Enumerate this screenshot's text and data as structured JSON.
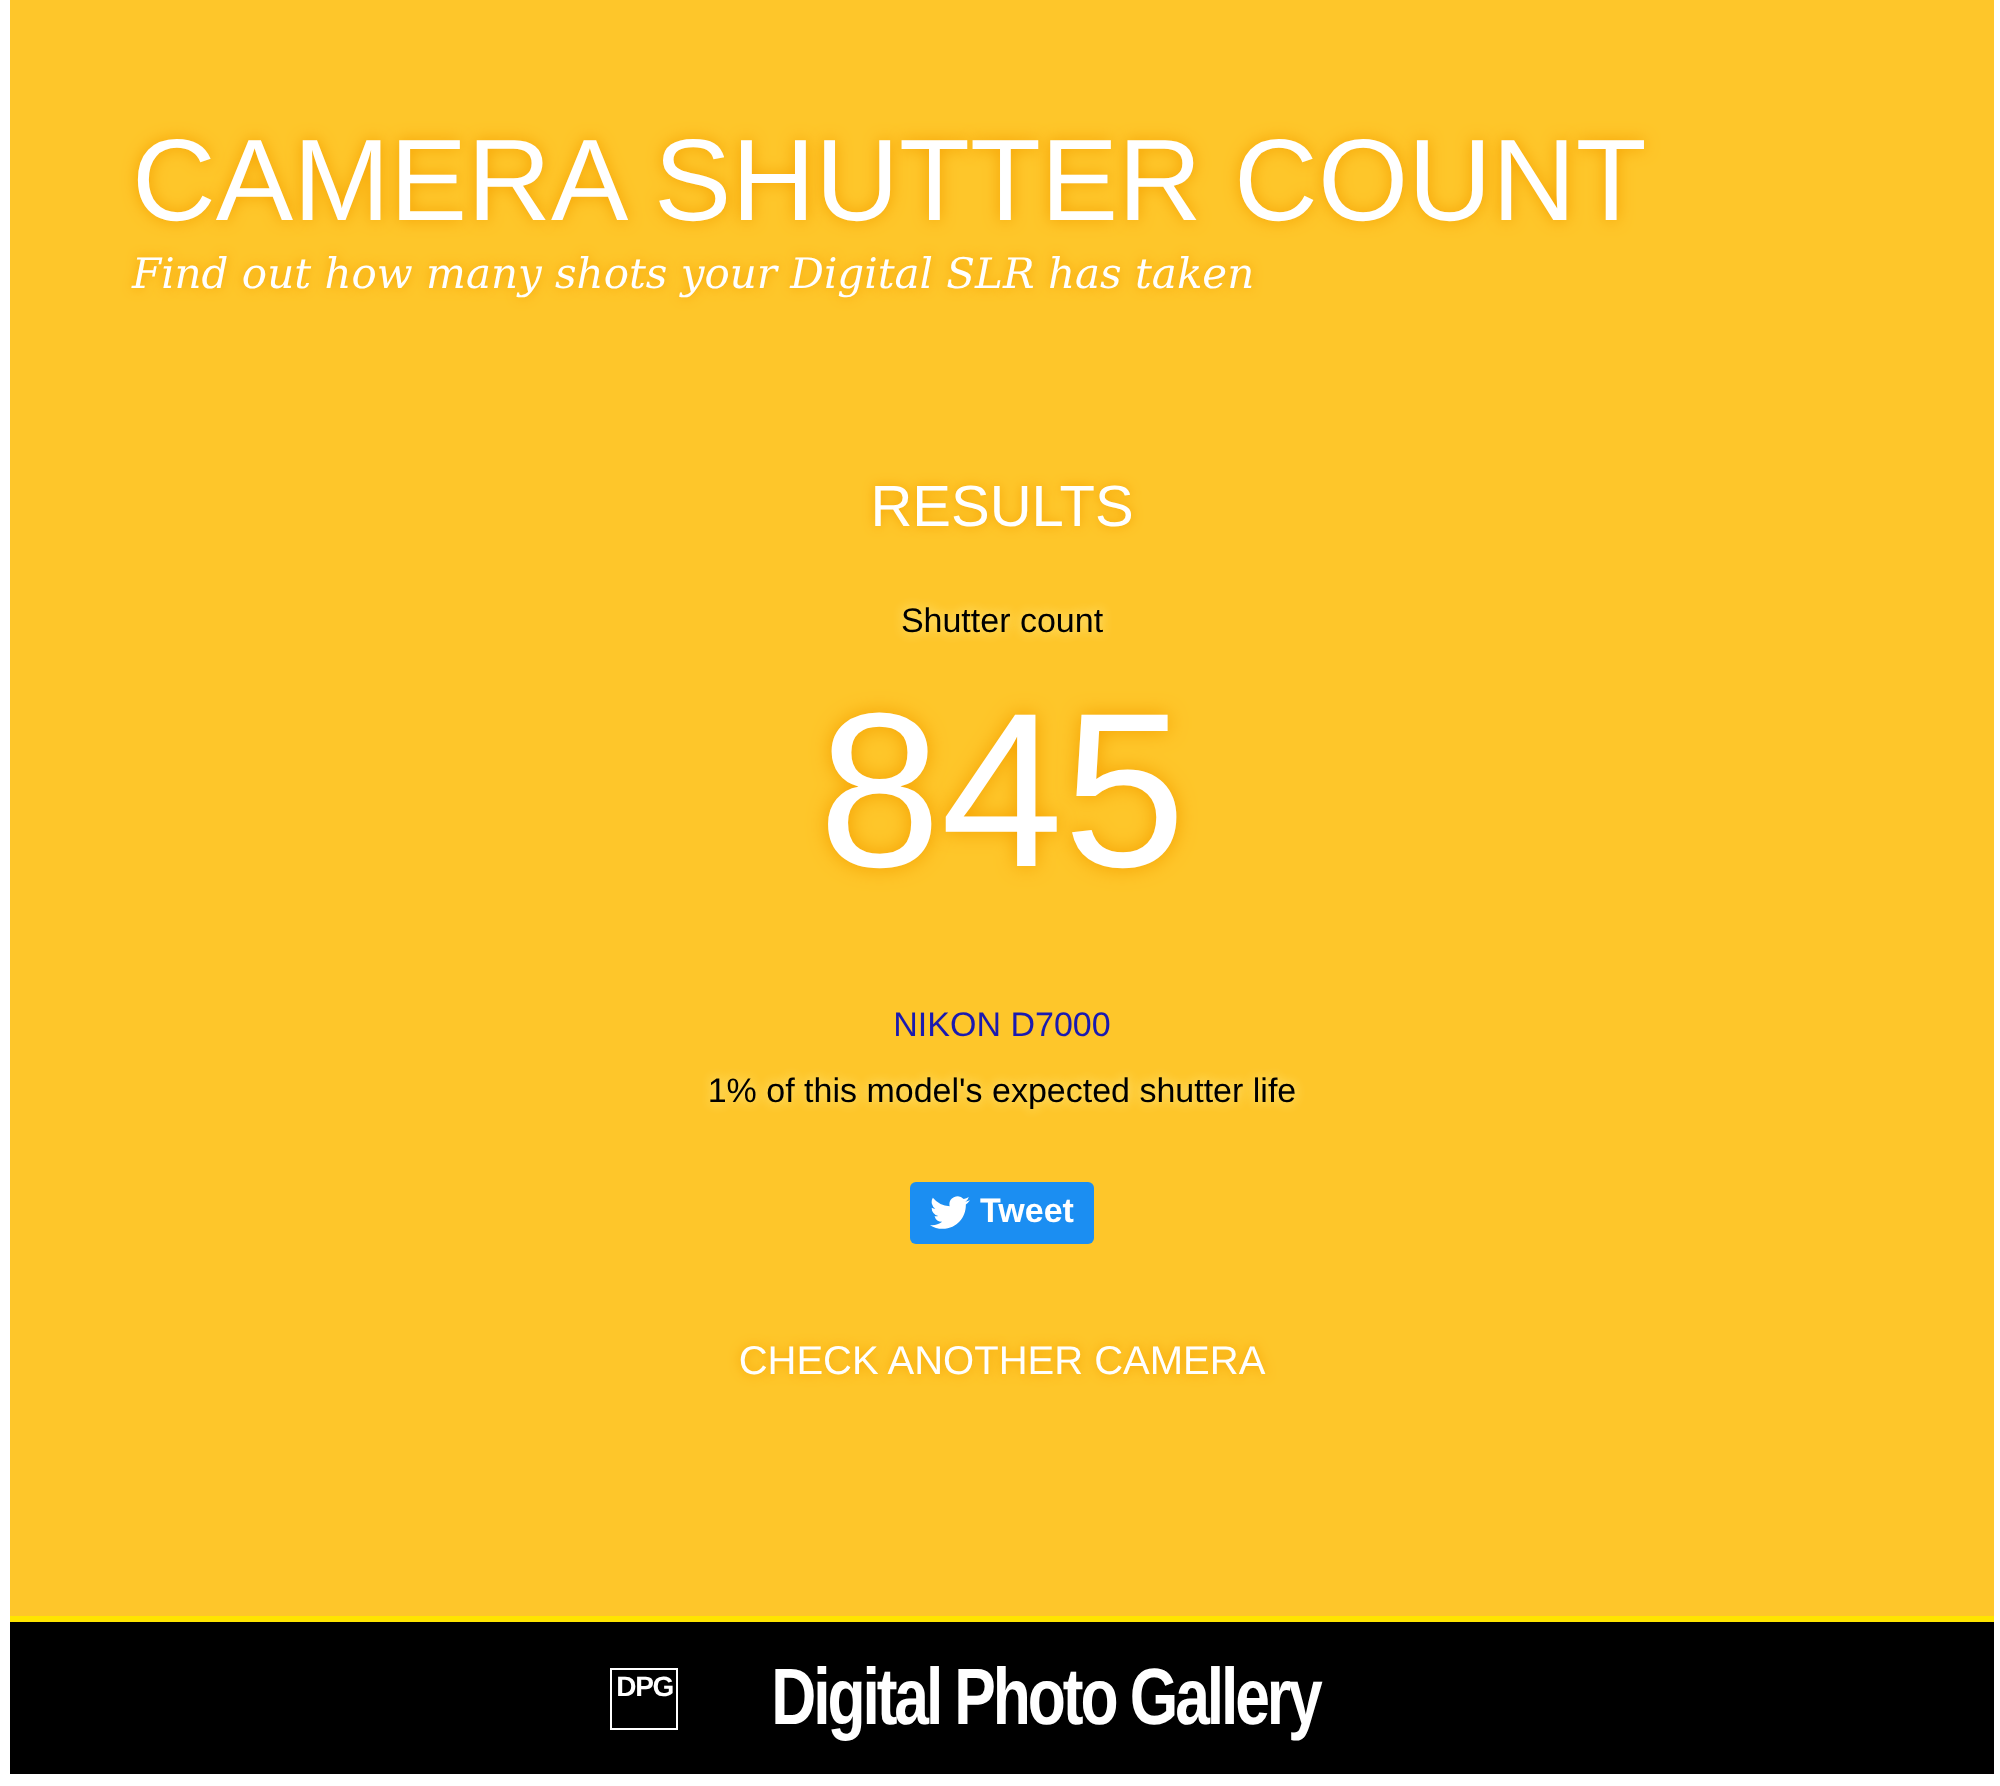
{
  "header": {
    "title": "CAMERA SHUTTER COUNT",
    "subtitle": "Find out how many shots your Digital SLR has taken"
  },
  "results": {
    "heading": "RESULTS",
    "label": "Shutter count",
    "count": "845",
    "model_link": "NIKON D7000",
    "note": "1% of this model's expected shutter life",
    "tweet_button": "Tweet",
    "check_another_link": "CHECK ANOTHER CAMERA"
  },
  "footer": {
    "logo_mark": "DPG",
    "brand": "Digital Photo Gallery"
  }
}
